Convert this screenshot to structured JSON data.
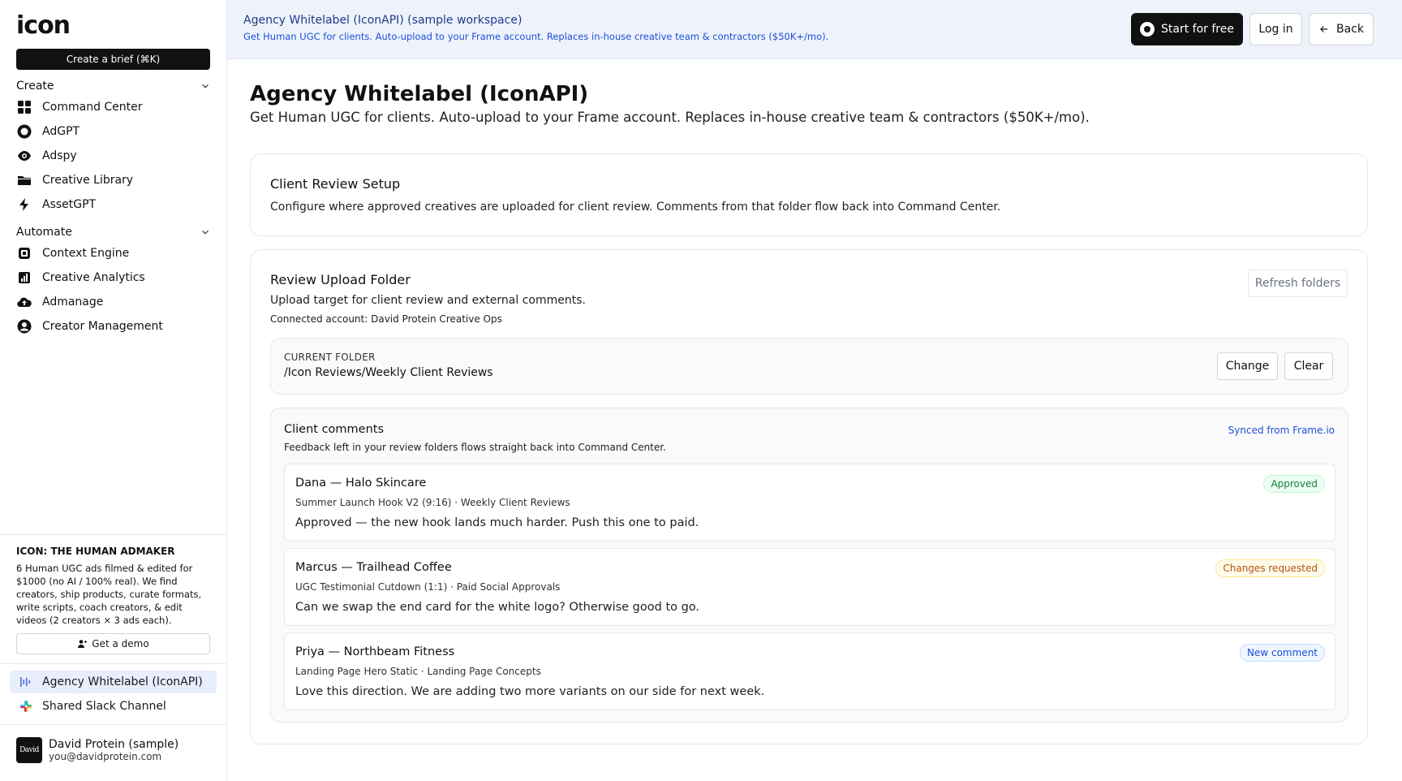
{
  "sidebar": {
    "logo": "icon",
    "create_brief": "Create a brief (⌘K)",
    "sections": [
      {
        "label": "Create",
        "items": [
          {
            "label": "Command Center",
            "icon": "grid-icon"
          },
          {
            "label": "AdGPT",
            "icon": "circle-logo-icon"
          },
          {
            "label": "Adspy",
            "icon": "eye-icon"
          },
          {
            "label": "Creative Library",
            "icon": "folder-icon"
          },
          {
            "label": "AssetGPT",
            "icon": "bolt-icon"
          }
        ]
      },
      {
        "label": "Automate",
        "items": [
          {
            "label": "Context Engine",
            "icon": "chip-icon"
          },
          {
            "label": "Creative Analytics",
            "icon": "bar-chart-icon"
          },
          {
            "label": "Admanage",
            "icon": "cloud-upload-icon"
          },
          {
            "label": "Creator Management",
            "icon": "user-circle-icon"
          }
        ]
      }
    ],
    "promo": {
      "title": "ICON: THE HUMAN ADMAKER",
      "text": "6 Human UGC ads filmed & edited for $1000 (no AI / 100% real). We find creators, ship products, curate formats, write scripts, coach creators, & edit videos (2 creators × 3 ads each).",
      "button": "Get a demo"
    },
    "workspaces": [
      {
        "label": "Agency Whitelabel (IconAPI)",
        "icon": "waveform-icon",
        "active": true
      },
      {
        "label": "Shared Slack Channel",
        "icon": "slack-icon",
        "active": false
      }
    ],
    "user": {
      "avatar_text": "David",
      "name": "David Protein (sample)",
      "email": "you@davidprotein.com"
    }
  },
  "banner": {
    "title": "Agency Whitelabel (IconAPI) (sample workspace)",
    "subtitle": "Get Human UGC for clients. Auto-upload to your Frame account. Replaces in-house creative team & contractors ($50K+/mo).",
    "start_label": "Start for free",
    "login_label": "Log in",
    "back_label": "Back"
  },
  "main": {
    "title": "Agency Whitelabel (IconAPI)",
    "subtitle": "Get Human UGC for clients. Auto-upload to your Frame account. Replaces in-house creative team & contractors ($50K+/mo).",
    "setup": {
      "title": "Client Review Setup",
      "description": "Configure where approved creatives are uploaded for client review. Comments from that folder flow back into Command Center."
    },
    "upload": {
      "title": "Review Upload Folder",
      "description": "Upload target for client review and external comments.",
      "account": "Connected account: David Protein Creative Ops",
      "refresh_label": "Refresh folders",
      "current_folder_label": "CURRENT FOLDER",
      "current_folder_path": "/Icon Reviews/Weekly Client Reviews",
      "change_label": "Change",
      "clear_label": "Clear"
    },
    "comments": {
      "title": "Client comments",
      "subtitle": "Feedback left in your review folders flows straight back into Command Center.",
      "synced_label": "Synced from Frame.io",
      "items": [
        {
          "author": "Dana — Halo Skincare",
          "meta": "Summer Launch Hook V2 (9:16) · Weekly Client Reviews",
          "body": "Approved — the new hook lands much harder. Push this one to paid.",
          "badge": "Approved",
          "badge_color": "#15803d",
          "badge_bg": "#ecfdf3",
          "badge_border": "#bbf7d0"
        },
        {
          "author": "Marcus — Trailhead Coffee",
          "meta": "UGC Testimonial Cutdown (1:1) · Paid Social Approvals",
          "body": "Can we swap the end card for the white logo? Otherwise good to go.",
          "badge": "Changes requested",
          "badge_color": "#b45309",
          "badge_bg": "#fffbeb",
          "badge_border": "#fde68a"
        },
        {
          "author": "Priya — Northbeam Fitness",
          "meta": "Landing Page Hero Static · Landing Page Concepts",
          "body": "Love this direction. We are adding two more variants on our side for next week.",
          "badge": "New comment",
          "badge_color": "#1d4ed8",
          "badge_bg": "#eff6ff",
          "badge_border": "#bfdbfe"
        }
      ]
    }
  }
}
